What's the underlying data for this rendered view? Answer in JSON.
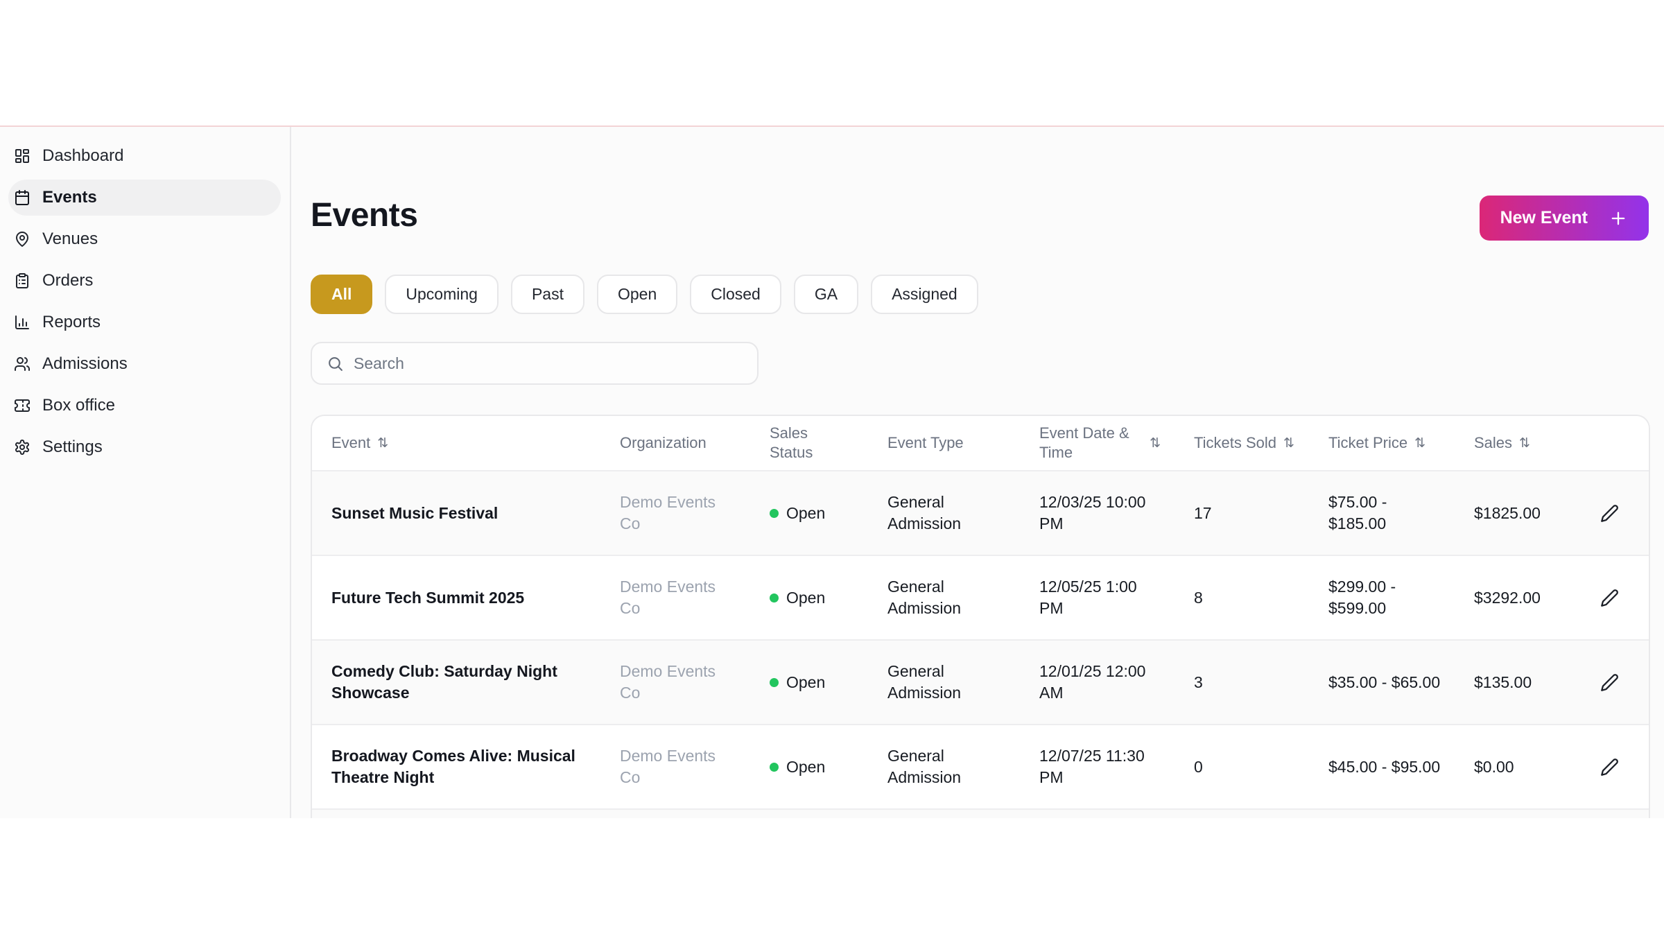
{
  "header": {
    "title": "Events",
    "new_event_button": {
      "label": "New Event",
      "icon": "plus-icon"
    }
  },
  "sidebar": {
    "items": [
      {
        "label": "Dashboard",
        "icon": "dashboard-icon",
        "active": false
      },
      {
        "label": "Events",
        "icon": "calendar-icon",
        "active": true
      },
      {
        "label": "Venues",
        "icon": "map-pin-icon",
        "active": false
      },
      {
        "label": "Orders",
        "icon": "clipboard-icon",
        "active": false
      },
      {
        "label": "Reports",
        "icon": "bar-chart-icon",
        "active": false
      },
      {
        "label": "Admissions",
        "icon": "users-icon",
        "active": false
      },
      {
        "label": "Box office",
        "icon": "ticket-icon",
        "active": false
      },
      {
        "label": "Settings",
        "icon": "gear-icon",
        "active": false
      }
    ]
  },
  "filters": [
    {
      "label": "All",
      "active": true
    },
    {
      "label": "Upcoming",
      "active": false
    },
    {
      "label": "Past",
      "active": false
    },
    {
      "label": "Open",
      "active": false
    },
    {
      "label": "Closed",
      "active": false
    },
    {
      "label": "GA",
      "active": false
    },
    {
      "label": "Assigned",
      "active": false
    }
  ],
  "search": {
    "placeholder": "Search",
    "icon": "search-icon"
  },
  "table": {
    "columns": [
      {
        "label": "Event",
        "sortable": true
      },
      {
        "label": "Organization",
        "sortable": false
      },
      {
        "label": "Sales Status",
        "sortable": false
      },
      {
        "label": "Event Type",
        "sortable": false
      },
      {
        "label": "Event Date & Time",
        "sortable": true
      },
      {
        "label": "Tickets Sold",
        "sortable": true
      },
      {
        "label": "Ticket Price",
        "sortable": true
      },
      {
        "label": "Sales",
        "sortable": true
      },
      {
        "label": "",
        "sortable": false
      }
    ],
    "rows": [
      {
        "event": "Sunset Music Festival",
        "organization": "Demo Events Co",
        "sales_status": "Open",
        "event_type": "General Admission",
        "datetime": "12/03/25 10:00 PM",
        "tickets_sold": "17",
        "ticket_price": "$75.00 - $185.00",
        "sales": "$1825.00"
      },
      {
        "event": "Future Tech Summit 2025",
        "organization": "Demo Events Co",
        "sales_status": "Open",
        "event_type": "General Admission",
        "datetime": "12/05/25 1:00 PM",
        "tickets_sold": "8",
        "ticket_price": "$299.00 - $599.00",
        "sales": "$3292.00"
      },
      {
        "event": "Comedy Club: Saturday Night Showcase",
        "organization": "Demo Events Co",
        "sales_status": "Open",
        "event_type": "General Admission",
        "datetime": "12/01/25 12:00 AM",
        "tickets_sold": "3",
        "ticket_price": "$35.00 - $65.00",
        "sales": "$135.00"
      },
      {
        "event": "Broadway Comes Alive: Musical Theatre Night",
        "organization": "Demo Events Co",
        "sales_status": "Open",
        "event_type": "General Admission",
        "datetime": "12/07/25 11:30 PM",
        "tickets_sold": "0",
        "ticket_price": "$45.00 - $95.00",
        "sales": "$0.00"
      }
    ]
  },
  "icons": {
    "sort_glyph": "⇅"
  },
  "colors": {
    "accent_gradient_start": "#db2777",
    "accent_gradient_end": "#9333ea",
    "active_filter_gold": "#c7991e",
    "status_open_green": "#22c55e",
    "top_divider_pink": "#f3d3d5",
    "row_stripe": "#fafafa"
  }
}
